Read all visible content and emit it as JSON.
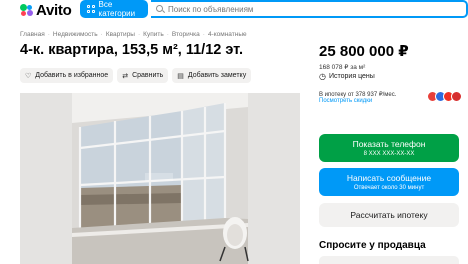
{
  "header": {
    "logo_text": "Avito",
    "categories_label": "Все категории",
    "search_placeholder": "Поиск по объявлениям"
  },
  "breadcrumb": [
    "Главная",
    "Недвижимость",
    "Квартиры",
    "Купить",
    "Вторичка",
    "4-комнатные"
  ],
  "listing": {
    "title": "4-к. квартира, 153,5 м², 11/12 эт.",
    "actions": {
      "favorite": "Добавить в избранное",
      "compare": "Сравнить",
      "note": "Добавить заметку"
    }
  },
  "sidebar": {
    "price": "25 800 000 ₽",
    "price_per_m2": "168 078 ₽ за м²",
    "price_history": "История цены",
    "mortgage": "В ипотеку от 378 937 ₽/мес.",
    "rates_link": "Посмотреть скидки",
    "bank_colors": [
      "#e8403a",
      "#2d6cdf",
      "#ef3124",
      "#d62f2f"
    ],
    "show_phone": "Показать телефон",
    "phone_masked": "8 XXX XXX-XX-XX",
    "write_message": "Написать сообщение",
    "reply_time": "Отвечает около 30 минут",
    "calc_mortgage": "Рассчитать ипотеку",
    "ask_seller": "Спросите у продавца"
  },
  "colors": {
    "accent": "#0099f7",
    "green": "#00a046",
    "link": "#0099f7"
  },
  "icons": {
    "favorite": "heart-icon",
    "compare": "compare-icon",
    "note": "note-icon",
    "history": "history-icon",
    "search": "search-icon",
    "categories": "grid-icon"
  }
}
